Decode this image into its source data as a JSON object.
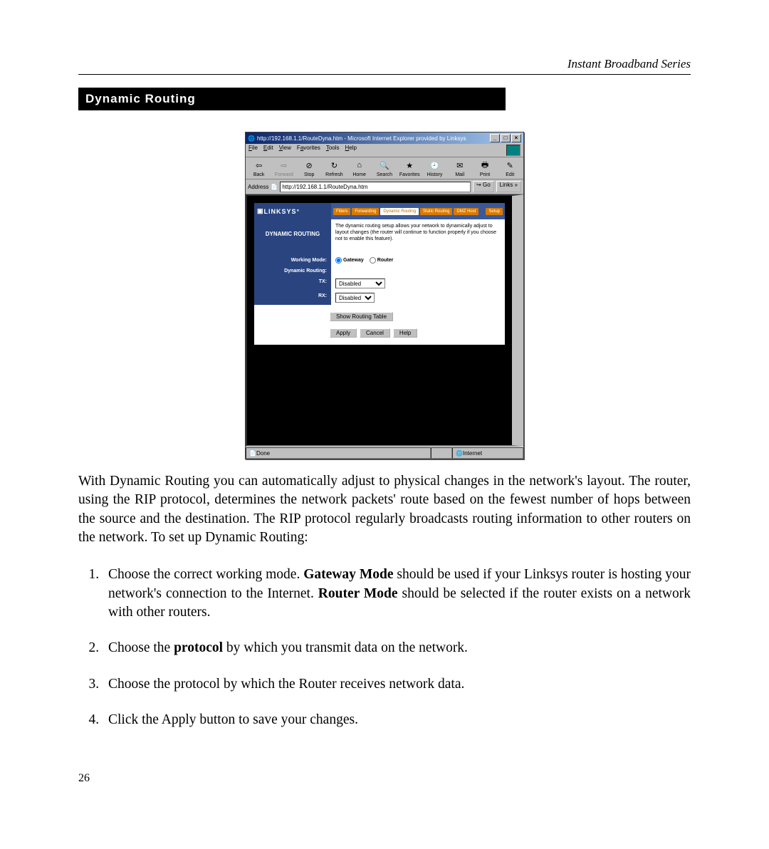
{
  "header": {
    "series": "Instant Broadband Series"
  },
  "section": {
    "title": "Dynamic Routing"
  },
  "window": {
    "title": "http://192.168.1.1/RouteDyna.htm - Microsoft Internet Explorer provided by Linksys",
    "menu": {
      "file": "File",
      "edit": "Edit",
      "view": "View",
      "favorites": "Favorites",
      "tools": "Tools",
      "help": "Help"
    },
    "toolbar": {
      "back": "Back",
      "forward": "Forward",
      "stop": "Stop",
      "refresh": "Refresh",
      "home": "Home",
      "search": "Search",
      "favorites": "Favorites",
      "history": "History",
      "mail": "Mail",
      "print": "Print",
      "edit": "Edit"
    },
    "address": {
      "label": "Address",
      "url": "http://192.168.1.1/RouteDyna.htm",
      "go": "Go",
      "links": "Links"
    },
    "status": {
      "done": "Done",
      "zone": "Internet"
    }
  },
  "router": {
    "logo": "LINKSYS",
    "tabs": {
      "filters": "Filters",
      "forwarding": "Forwarding",
      "dynamic": "Dynamic Routing",
      "static": "Static Routing",
      "dmz": "DMZ Host",
      "setup": "Setup"
    },
    "side_title": "DYNAMIC ROUTING",
    "description": "The dynamic routing setup allows your network to dynamically adjust to layout changes (the router will continue to function properly if you choose not to enable this feature).",
    "labels": {
      "working_mode": "Working Mode:",
      "dyn": "Dynamic Routing:",
      "tx": "TX:",
      "rx": "RX:"
    },
    "options": {
      "gateway": "Gateway",
      "router": "Router",
      "disabled": "Disabled"
    },
    "buttons": {
      "show": "Show Routing Table",
      "apply": "Apply",
      "cancel": "Cancel",
      "help": "Help"
    }
  },
  "body": {
    "para": "With Dynamic Routing you can automatically adjust to physical changes in the network's layout. The router, using the RIP protocol, determines the network packets' route based on the fewest number of hops between the source and the destination. The RIP protocol regularly broadcasts routing information to other routers on the network. To set up Dynamic Routing:",
    "step1_a": "Choose the correct working mode. ",
    "step1_b": "Gateway Mode",
    "step1_c": " should be used if your Linksys router is hosting your network's connection to the Internet. ",
    "step1_d": "Router Mode",
    "step1_e": " should be selected if the router exists on a network with other routers.",
    "step2_a": "Choose the ",
    "step2_b": "protocol",
    "step2_c": " by which you transmit data on the network.",
    "step3": "Choose the protocol by which the Router receives network data.",
    "step4": "Click the Apply button to save your changes."
  },
  "page_number": "26"
}
